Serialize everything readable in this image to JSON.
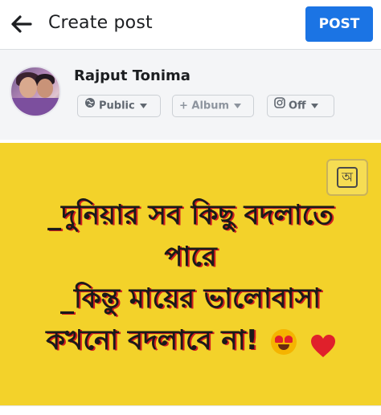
{
  "header": {
    "title": "Create post",
    "post_label": "POST"
  },
  "author": {
    "name": "Rajput Tonima",
    "audience_label": "Public",
    "album_label": "+ Album",
    "instagram_label": "Off"
  },
  "post": {
    "lines": [
      "_দুনিয়ার সব কিছু বদলাতে",
      "পারে",
      "_কিন্তু মায়ের ভালোবাসা",
      "কখনো বদলাবে না!"
    ],
    "font_button_label": "অ",
    "background_color": "#f3d22a",
    "emojis": [
      "heart-eyes-emoji",
      "red-heart-emoji"
    ]
  },
  "colors": {
    "accent": "#1b74e4",
    "text_shadow": "#d21f1f"
  }
}
